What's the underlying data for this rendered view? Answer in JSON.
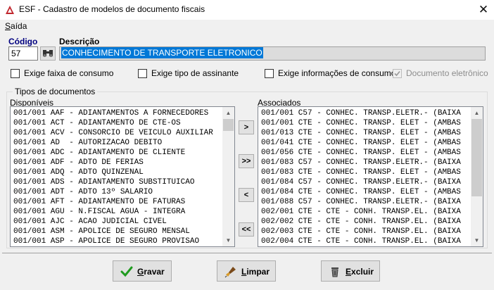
{
  "window": {
    "title": "ESF - Cadastro de modelos de documento fiscais",
    "close_glyph": "✕"
  },
  "menu": {
    "items": [
      {
        "label_first": "S",
        "label_rest": "aída"
      }
    ]
  },
  "form": {
    "codigo_label": "Código",
    "codigo_value": "57",
    "descricao_label": "Descrição",
    "descricao_value": "CONHECIMENTO DE TRANSPORTE ELETRONICO"
  },
  "checkboxes": [
    {
      "label": "Exige faixa de consumo",
      "checked": false,
      "disabled": false
    },
    {
      "label": "Exige tipo de assinante",
      "checked": false,
      "disabled": false
    },
    {
      "label": "Exige informações de consumo",
      "checked": false,
      "disabled": false
    },
    {
      "label": "Documento eletrônico",
      "checked": true,
      "disabled": true
    }
  ],
  "tipos": {
    "group_title": "Tipos de documentos",
    "disponiveis_label": "Disponíveis",
    "associados_label": "Associados",
    "disponiveis": [
      "001/001 AAF - ADIANTAMENTOS A FORNECEDORES",
      "001/001 ACT - ADIANTAMENTO DE CTE-OS",
      "001/001 ACV - CONSORCIO DE VEICULO AUXILIAR",
      "001/001 AD  - AUTORIZACAO DEBITO",
      "001/001 ADC - ADIANTAMENTO DE CLIENTE",
      "001/001 ADF - ADTO DE FERIAS",
      "001/001 ADQ - ADTO QUINZENAL",
      "001/001 ADS - ADIANTAMENTO SUBSTITUICAO",
      "001/001 ADT - ADTO 13º SALARIO",
      "001/001 AFT - ADIANTAMENTO DE FATURAS",
      "001/001 AGU - N.FISCAL AGUA - INTEGRA",
      "001/001 AJC - ACAO JUDICIAL CIVEL",
      "001/001 ASM - APOLICE DE SEGURO MENSAL",
      "001/001 ASP - APOLICE DE SEGURO PROVISAO"
    ],
    "associados": [
      "001/001 C57 - CONHEC. TRANSP.ELETR.- (BAIXA",
      "001/001 CTE - CONHEC. TRANSP. ELET - (AMBAS",
      "001/013 CTE - CONHEC. TRANSP. ELET - (AMBAS",
      "001/041 CTE - CONHEC. TRANSP. ELET - (AMBAS",
      "001/056 CTE - CONHEC. TRANSP. ELET - (AMBAS",
      "001/083 C57 - CONHEC. TRANSP.ELETR.- (BAIXA",
      "001/083 CTE - CONHEC. TRANSP. ELET - (AMBAS",
      "001/084 C57 - CONHEC. TRANSP.ELETR.- (BAIXA",
      "001/084 CTE - CONHEC. TRANSP. ELET - (AMBAS",
      "001/088 C57 - CONHEC. TRANSP.ELETR.- (BAIXA",
      "002/001 CTE - CTE - CONH. TRANSP.EL. (BAIXA",
      "002/002 CTE - CTE - CONH. TRANSP.EL. (BAIXA",
      "002/003 CTE - CTE - CONH. TRANSP.EL. (BAIXA",
      "002/004 CTE - CTE - CONH. TRANSP.EL. (BAIXA"
    ],
    "buttons": {
      "add": ">",
      "add_all": ">>",
      "remove": "<",
      "remove_all": "<<"
    }
  },
  "actions": {
    "gravar": {
      "first": "G",
      "rest": "ravar"
    },
    "limpar": {
      "first": "L",
      "rest": "impar"
    },
    "excluir": {
      "first": "E",
      "rest": "xcluir"
    }
  },
  "colors": {
    "accent": "#0078d7",
    "codigo_label": "#000080"
  },
  "icons": {
    "app": "app-logo-icon",
    "lookup": "binoculars-icon",
    "gravar": "checkmark-icon",
    "limpar": "brush-icon",
    "excluir": "trash-icon"
  }
}
